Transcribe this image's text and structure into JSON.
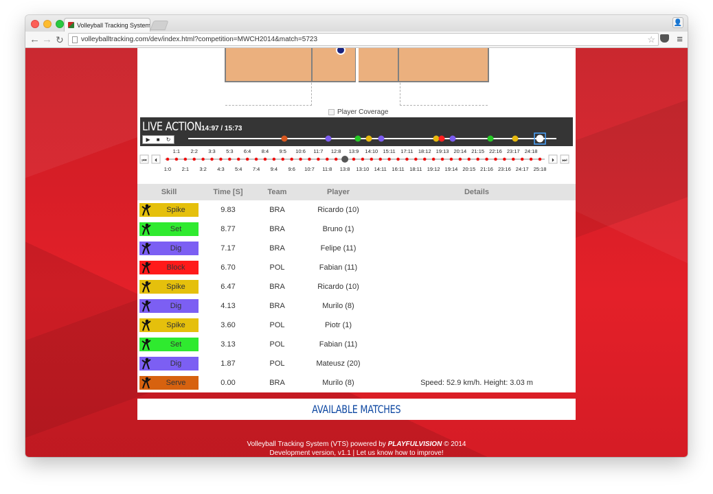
{
  "browser": {
    "tab_title": "Volleyball Tracking System",
    "url": "volleyballtracking.com/dev/index.html?competition=MWCH2014&match=5723"
  },
  "court": {
    "coverage_label": "Player Coverage"
  },
  "live_action": {
    "title": "LIVE ACTION",
    "time": "14:97 / 15:73",
    "events": [
      {
        "color": "#d9581f"
      },
      {
        "color": "#7b5cf0"
      },
      {
        "color": "#26c926"
      },
      {
        "color": "#e7b90e"
      },
      {
        "color": "#7b5cf0"
      },
      {
        "color": "#e7b90e"
      },
      {
        "color": "#ff2020"
      },
      {
        "color": "#7b5cf0"
      },
      {
        "color": "#26c926"
      },
      {
        "color": "#e7b90e"
      },
      {
        "color": "#ffffff"
      }
    ]
  },
  "scores": {
    "top": [
      "1:1",
      "2:2",
      "3:3",
      "5:3",
      "6:4",
      "8:4",
      "9:5",
      "10:6",
      "11:7",
      "12:8",
      "13:9",
      "14:10",
      "15:11",
      "17:11",
      "18:12",
      "19:13",
      "20:14",
      "21:15",
      "22:16",
      "23:17",
      "24:18"
    ],
    "bottom": [
      "1:0",
      "2:1",
      "3:2",
      "4:3",
      "5:4",
      "7:4",
      "9:4",
      "9:6",
      "10:7",
      "11:8",
      "13:8",
      "13:10",
      "14:11",
      "16:11",
      "18:11",
      "19:12",
      "19:14",
      "20:15",
      "21:16",
      "23:16",
      "24:17",
      "25:18"
    ],
    "current_index": 10
  },
  "table": {
    "headers": {
      "skill": "Skill",
      "time": "Time [S]",
      "team": "Team",
      "player": "Player",
      "details": "Details"
    },
    "rows": [
      {
        "skill": "Spike",
        "time": "9.83",
        "team": "BRA",
        "player": "Ricardo (10)",
        "details": "",
        "color": "#e5c00c"
      },
      {
        "skill": "Set",
        "time": "8.77",
        "team": "BRA",
        "player": "Bruno (1)",
        "details": "",
        "color": "#2fea2f"
      },
      {
        "skill": "Dig",
        "time": "7.17",
        "team": "BRA",
        "player": "Felipe (11)",
        "details": "",
        "color": "#7c5ff3"
      },
      {
        "skill": "Block",
        "time": "6.70",
        "team": "POL",
        "player": "Fabian (11)",
        "details": "",
        "color": "#ff1a1a"
      },
      {
        "skill": "Spike",
        "time": "6.47",
        "team": "BRA",
        "player": "Ricardo (10)",
        "details": "",
        "color": "#e5c00c"
      },
      {
        "skill": "Dig",
        "time": "4.13",
        "team": "BRA",
        "player": "Murilo (8)",
        "details": "",
        "color": "#7c5ff3"
      },
      {
        "skill": "Spike",
        "time": "3.60",
        "team": "POL",
        "player": "Piotr (1)",
        "details": "",
        "color": "#e5c00c"
      },
      {
        "skill": "Set",
        "time": "3.13",
        "team": "POL",
        "player": "Fabian (11)",
        "details": "",
        "color": "#2fea2f"
      },
      {
        "skill": "Dig",
        "time": "1.87",
        "team": "POL",
        "player": "Mateusz (20)",
        "details": "",
        "color": "#7c5ff3"
      },
      {
        "skill": "Serve",
        "time": "0.00",
        "team": "BRA",
        "player": "Murilo (8)",
        "details": "Speed: 52.9 km/h. Height: 3.03 m",
        "color": "#d7620f"
      }
    ]
  },
  "available_matches": "AVAILABLE MATCHES",
  "footer": {
    "line1_prefix": "Volleyball Tracking System (VTS) powered by",
    "brand": "PLAYFULVISION",
    "line1_suffix": "© 2014",
    "line2": "Development version, v1.1 | Let us know how to improve!"
  }
}
